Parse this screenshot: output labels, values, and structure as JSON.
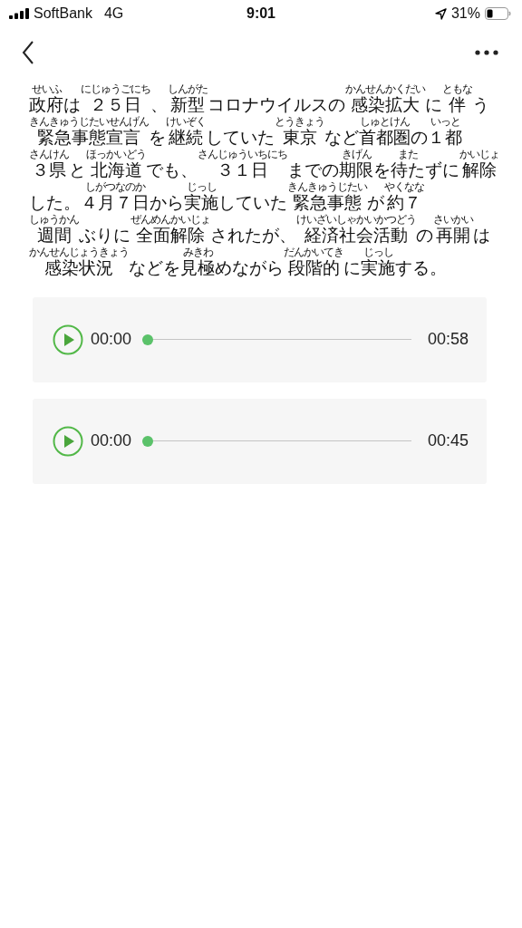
{
  "status_bar": {
    "carrier": "SoftBank",
    "network": "4G",
    "time": "9:01",
    "battery": "31%"
  },
  "article": {
    "lines": [
      [
        {
          "text": "政府",
          "ruby": "せいふ"
        },
        {
          "text": "は"
        },
        {
          "text": "２５日",
          "ruby": "にじゅうごにち"
        },
        {
          "text": "、"
        },
        {
          "text": "新型",
          "ruby": "しんがた"
        },
        {
          "text": "コロナウイルスの"
        },
        {
          "text": "感染拡大",
          "ruby": "かんせんかくだい"
        },
        {
          "text": "に"
        },
        {
          "text": "伴",
          "ruby": "ともな"
        },
        {
          "text": "う"
        }
      ],
      [
        {
          "text": "緊急事態宣言",
          "ruby": "きんきゅうじたいせんげん"
        },
        {
          "text": "を"
        },
        {
          "text": "継続",
          "ruby": "けいぞく"
        },
        {
          "text": "していた"
        },
        {
          "text": "東京",
          "ruby": "とうきょう"
        },
        {
          "text": "など"
        },
        {
          "text": "首都圏",
          "ruby": "しゅとけん"
        },
        {
          "text": "の"
        },
        {
          "text": "１都",
          "ruby": "いっと"
        }
      ],
      [
        {
          "text": "３県",
          "ruby": "さんけん"
        },
        {
          "text": "と"
        },
        {
          "text": "北海道",
          "ruby": "ほっかいどう"
        },
        {
          "text": "でも、"
        },
        {
          "text": "３１日",
          "ruby": "さんじゅういちにち"
        },
        {
          "text": "までの"
        },
        {
          "text": "期限",
          "ruby": "きげん"
        },
        {
          "text": "を"
        },
        {
          "text": "待た",
          "ruby": "また"
        },
        {
          "text": "ずに"
        },
        {
          "text": "解除",
          "ruby": "かいじょ"
        }
      ],
      [
        {
          "text": "した。"
        },
        {
          "text": "４月７日",
          "ruby": "しがつなのか"
        },
        {
          "text": "から"
        },
        {
          "text": "実施",
          "ruby": "じっし"
        },
        {
          "text": "していた"
        },
        {
          "text": "緊急事態",
          "ruby": "きんきゅうじたい"
        },
        {
          "text": "が"
        },
        {
          "text": "約７",
          "ruby": "やくなな"
        }
      ],
      [
        {
          "text": "週間",
          "ruby": "しゅうかん"
        },
        {
          "text": "ぶりに"
        },
        {
          "text": "全面解除",
          "ruby": "ぜんめんかいじょ"
        },
        {
          "text": "されたが、"
        },
        {
          "text": "経済社会活動",
          "ruby": "けいざいしゃかいかつどう"
        },
        {
          "text": "の"
        },
        {
          "text": "再開",
          "ruby": "さいかい"
        },
        {
          "text": "は"
        }
      ],
      [
        {
          "text": "感染状況",
          "ruby": "かんせんじょうきょう"
        },
        {
          "text": "など"
        },
        {
          "text": "を"
        },
        {
          "text": "見極",
          "ruby": "みきわ"
        },
        {
          "text": "めながら"
        },
        {
          "text": "段階的",
          "ruby": "だんかいてき"
        },
        {
          "text": "に"
        },
        {
          "text": "実施",
          "ruby": "じっし"
        },
        {
          "text": "する。"
        }
      ]
    ]
  },
  "audio_players": [
    {
      "current": "00:00",
      "level": 0,
      "duration": "00:58"
    },
    {
      "current": "00:00",
      "level": 0,
      "duration": "00:45"
    }
  ]
}
